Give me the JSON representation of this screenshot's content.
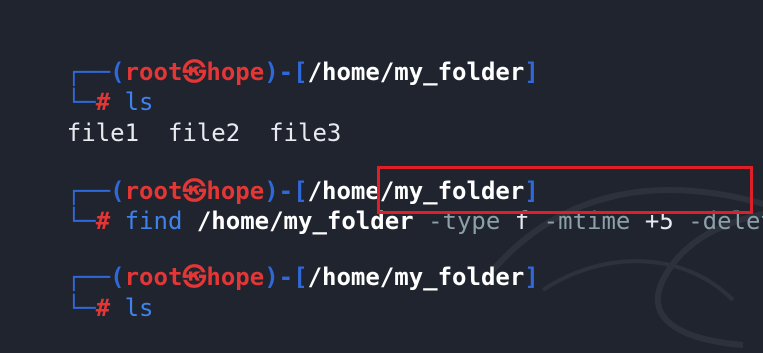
{
  "prompt": {
    "open_paren": "(",
    "user": "root",
    "skull": "㉿",
    "host": "hope",
    "close_paren": ")",
    "dash": "-",
    "lbracket": "[",
    "cwd": "/home/my_folder",
    "rbracket": "]",
    "hash": "#"
  },
  "blocks": [
    {
      "command": "ls"
    },
    {
      "command": "find",
      "path_arg": "/home/my_folder",
      "rest": [
        "-type",
        "f",
        "-mtime",
        "+5",
        "-delete"
      ]
    },
    {
      "command": "ls"
    }
  ],
  "output": {
    "files": [
      "file1",
      "file2",
      "file3"
    ]
  },
  "colors": {
    "background": "#20242e",
    "frame": "#2f68d9",
    "user": "#e53636",
    "highlight_box": "#e01e28"
  }
}
